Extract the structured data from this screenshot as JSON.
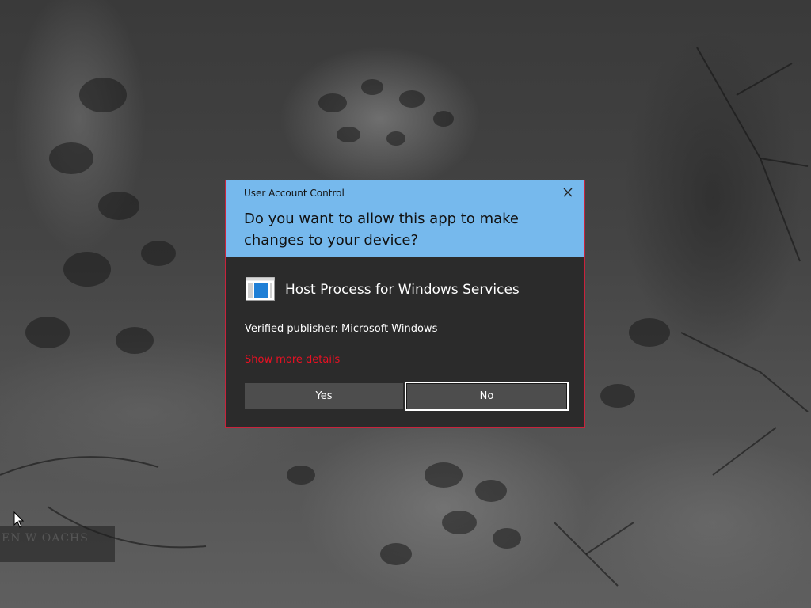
{
  "wallpaper": {
    "watermark_text": "EN W OACHS"
  },
  "dialog": {
    "window_title": "User Account Control",
    "question": "Do you want to allow this app to make changes to your device?",
    "app_name": "Host Process for Windows Services",
    "publisher": "Verified publisher: Microsoft Windows",
    "details_link": "Show more details",
    "buttons": {
      "yes": "Yes",
      "no": "No"
    },
    "icons": {
      "close": "close-icon",
      "app": "window-app-icon"
    }
  },
  "colors": {
    "header": "#76b9ed",
    "border": "#c8233c",
    "body": "#2b2b2b",
    "link": "#e81123",
    "button": "#4d4d4d"
  }
}
